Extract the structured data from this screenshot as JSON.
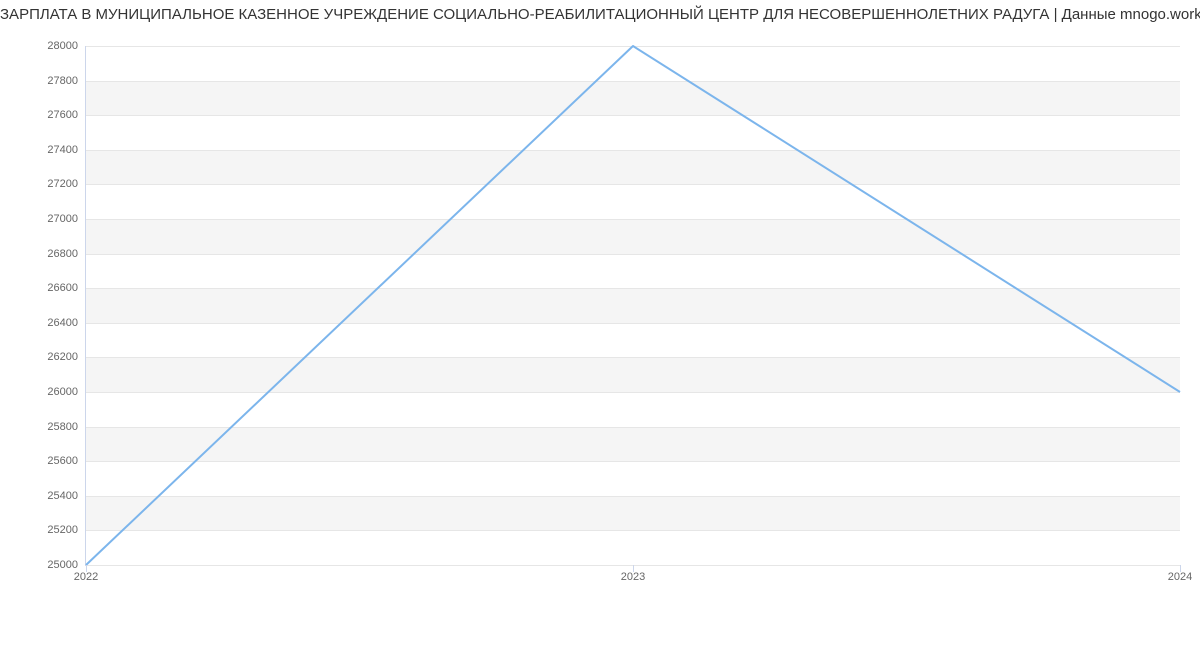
{
  "chart_data": {
    "type": "line",
    "title": "ЗАРПЛАТА В МУНИЦИПАЛЬНОЕ КАЗЕННОЕ УЧРЕЖДЕНИЕ СОЦИАЛЬНО-РЕАБИЛИТАЦИОННЫЙ ЦЕНТР ДЛЯ НЕСОВЕРШЕННОЛЕТНИХ РАДУГА | Данные mnogo.work",
    "xlabel": "",
    "ylabel": "",
    "x": [
      "2022",
      "2023",
      "2024"
    ],
    "values": [
      25000,
      28000,
      26000
    ],
    "x_ticks": [
      "2022",
      "2023",
      "2024"
    ],
    "y_ticks": [
      25000,
      25200,
      25400,
      25600,
      25800,
      26000,
      26200,
      26400,
      26600,
      26800,
      27000,
      27200,
      27400,
      27600,
      27800,
      28000
    ],
    "ylim": [
      25000,
      28000
    ],
    "series_color": "#7cb5ec",
    "grid": true
  }
}
